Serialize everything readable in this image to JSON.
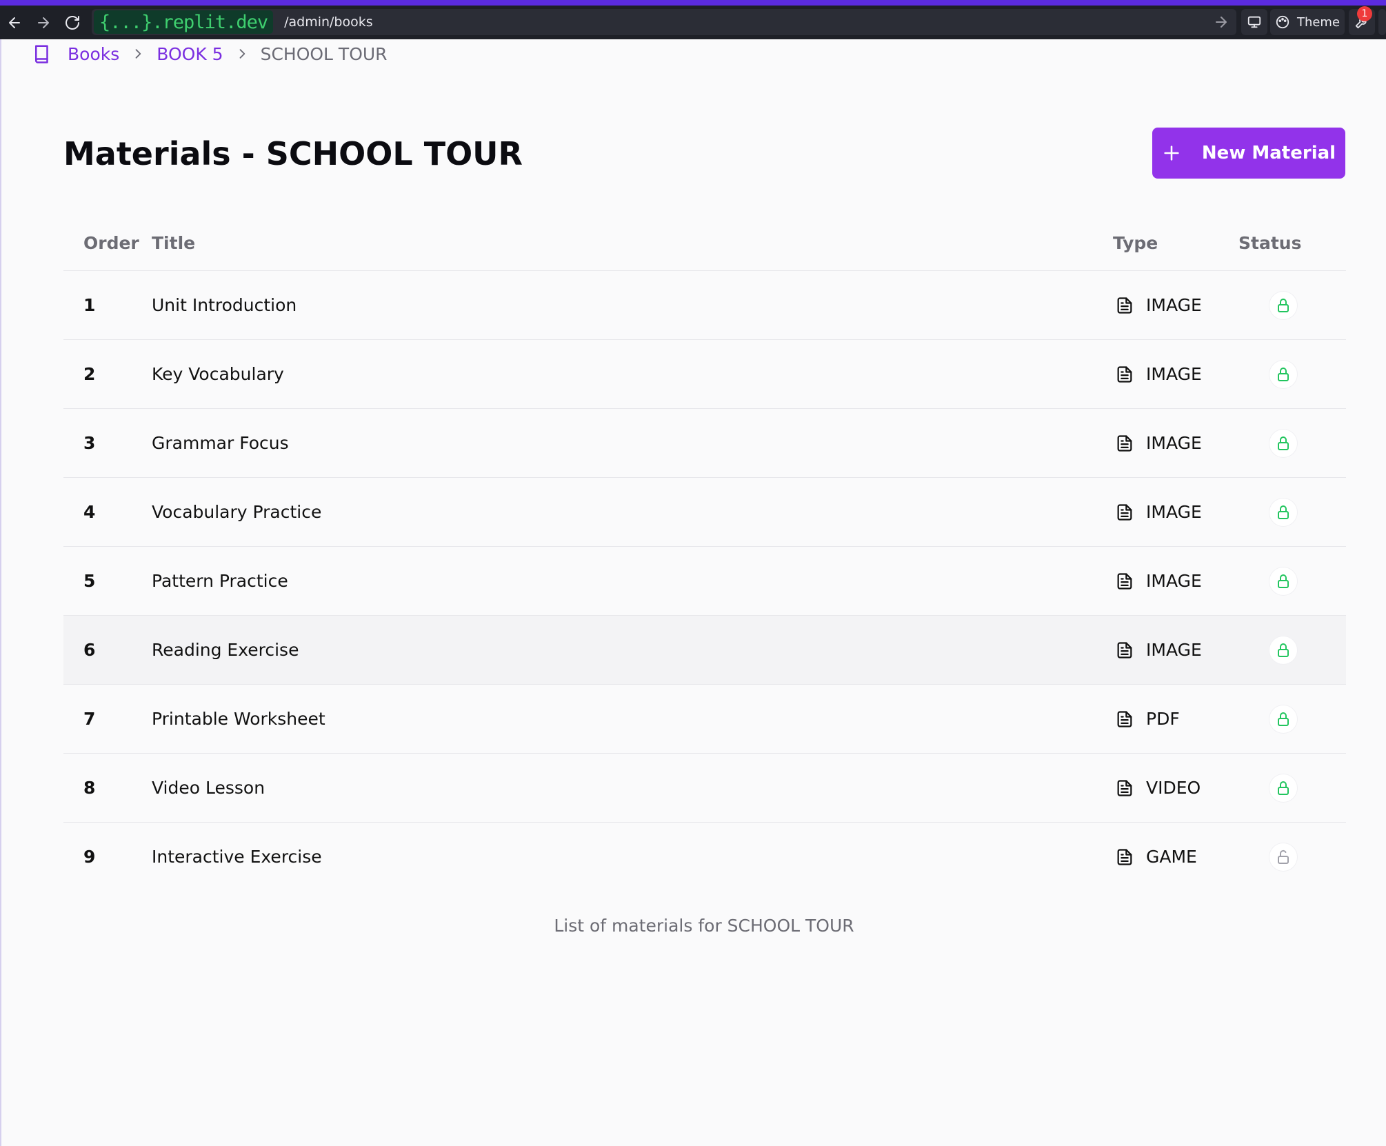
{
  "browser": {
    "domain": "{...}.replit.dev",
    "path": "/admin/books",
    "theme_label": "Theme",
    "notification_count": "1"
  },
  "breadcrumb": {
    "items": [
      {
        "label": "Books"
      },
      {
        "label": "BOOK 5"
      },
      {
        "label": "SCHOOL TOUR"
      }
    ]
  },
  "page": {
    "title": "Materials - SCHOOL TOUR",
    "new_button_label": "New Material",
    "caption": "List of materials for SCHOOL TOUR"
  },
  "table": {
    "columns": [
      "Order",
      "Title",
      "Type",
      "Status"
    ],
    "rows": [
      {
        "order": "1",
        "title": "Unit Introduction",
        "type": "IMAGE",
        "locked": true
      },
      {
        "order": "2",
        "title": "Key Vocabulary",
        "type": "IMAGE",
        "locked": true
      },
      {
        "order": "3",
        "title": "Grammar Focus",
        "type": "IMAGE",
        "locked": true
      },
      {
        "order": "4",
        "title": "Vocabulary Practice",
        "type": "IMAGE",
        "locked": true
      },
      {
        "order": "5",
        "title": "Pattern Practice",
        "type": "IMAGE",
        "locked": true
      },
      {
        "order": "6",
        "title": "Reading Exercise",
        "type": "IMAGE",
        "locked": true
      },
      {
        "order": "7",
        "title": "Printable Worksheet",
        "type": "PDF",
        "locked": true
      },
      {
        "order": "8",
        "title": "Video Lesson",
        "type": "VIDEO",
        "locked": true
      },
      {
        "order": "9",
        "title": "Interactive Exercise",
        "type": "GAME",
        "locked": false
      }
    ]
  },
  "colors": {
    "accent": "#9233ea",
    "link": "#7a2ee0",
    "locked": "#22c55e",
    "unlocked": "#a1a1aa"
  }
}
